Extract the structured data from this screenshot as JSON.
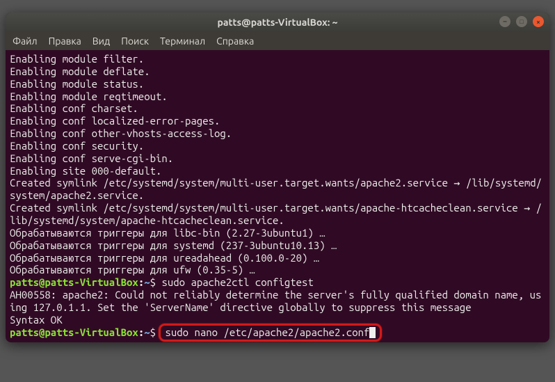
{
  "window": {
    "title": "patts@patts-VirtualBox: ~"
  },
  "menu": {
    "file": "Файл",
    "edit": "Правка",
    "view": "Вид",
    "search": "Поиск",
    "terminal": "Терминал",
    "help": "Справка"
  },
  "term": {
    "l1": "Enabling module filter.",
    "l2": "Enabling module deflate.",
    "l3": "Enabling module status.",
    "l4": "Enabling module reqtimeout.",
    "l5": "Enabling conf charset.",
    "l6": "Enabling conf localized-error-pages.",
    "l7": "Enabling conf other-vhosts-access-log.",
    "l8": "Enabling conf security.",
    "l9": "Enabling conf serve-cgi-bin.",
    "l10": "Enabling site 000-default.",
    "l11": "Created symlink /etc/systemd/system/multi-user.target.wants/apache2.service → /lib/systemd/system/apache2.service.",
    "l12": "Created symlink /etc/systemd/system/multi-user.target.wants/apache-htcacheclean.service → /lib/systemd/system/apache-htcacheclean.service.",
    "l13": "Обрабатываются триггеры для libc-bin (2.27-3ubuntu1) …",
    "l14": "Обрабатываются триггеры для systemd (237-3ubuntu10.13) …",
    "l15": "Обрабатываются триггеры для ureadahead (0.100.0-20) …",
    "l16": "Обрабатываются триггеры для ufw (0.35-5) …",
    "prompt_user": "patts@patts-VirtualBox",
    "prompt_path": "~",
    "cmd1": "sudo apache2ctl configtest",
    "l17": "AH00558: apache2: Could not reliably determine the server's fully qualified domain name, using 127.0.1.1. Set the 'ServerName' directive globally to suppress this message",
    "l18": "Syntax OK",
    "cmd2": "sudo nano /etc/apache2/apache2.conf"
  }
}
